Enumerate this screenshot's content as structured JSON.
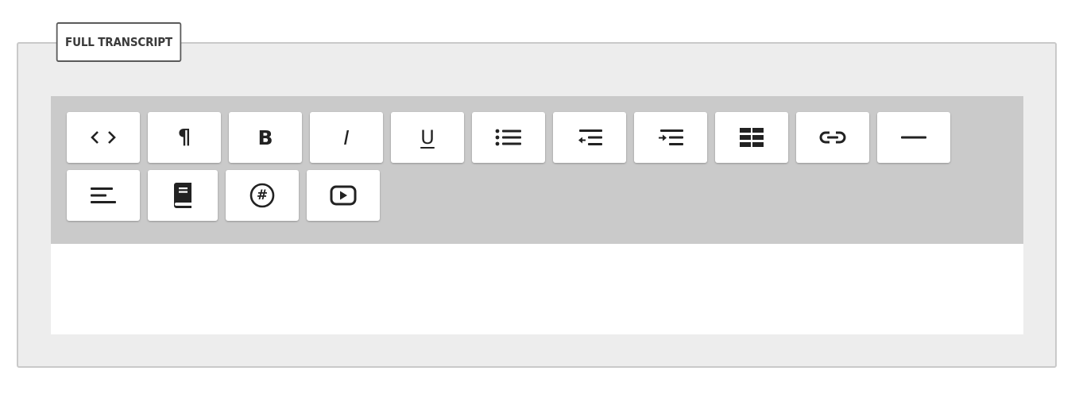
{
  "field": {
    "legend": "FULL TRANSCRIPT"
  },
  "toolbar": {
    "buttons": [
      {
        "name": "source-code",
        "icon": "code-icon",
        "glyph": "<>"
      },
      {
        "name": "paragraph",
        "icon": "pilcrow-icon",
        "glyph": "¶"
      },
      {
        "name": "bold",
        "icon": "bold-icon",
        "glyph": "B"
      },
      {
        "name": "italic",
        "icon": "italic-icon",
        "glyph": "I"
      },
      {
        "name": "underline",
        "icon": "underline-icon",
        "glyph": "U"
      },
      {
        "name": "unordered-list",
        "icon": "list-icon"
      },
      {
        "name": "outdent",
        "icon": "outdent-icon"
      },
      {
        "name": "indent",
        "icon": "indent-icon"
      },
      {
        "name": "table",
        "icon": "table-icon"
      },
      {
        "name": "link",
        "icon": "link-icon"
      },
      {
        "name": "horizontal-rule",
        "icon": "horizontal-rule-icon"
      },
      {
        "name": "align",
        "icon": "align-left-icon"
      },
      {
        "name": "book",
        "icon": "book-icon"
      },
      {
        "name": "hashtag",
        "icon": "hashtag-icon",
        "glyph": "#"
      },
      {
        "name": "video",
        "icon": "video-play-icon"
      }
    ]
  },
  "editor": {
    "content": ""
  }
}
